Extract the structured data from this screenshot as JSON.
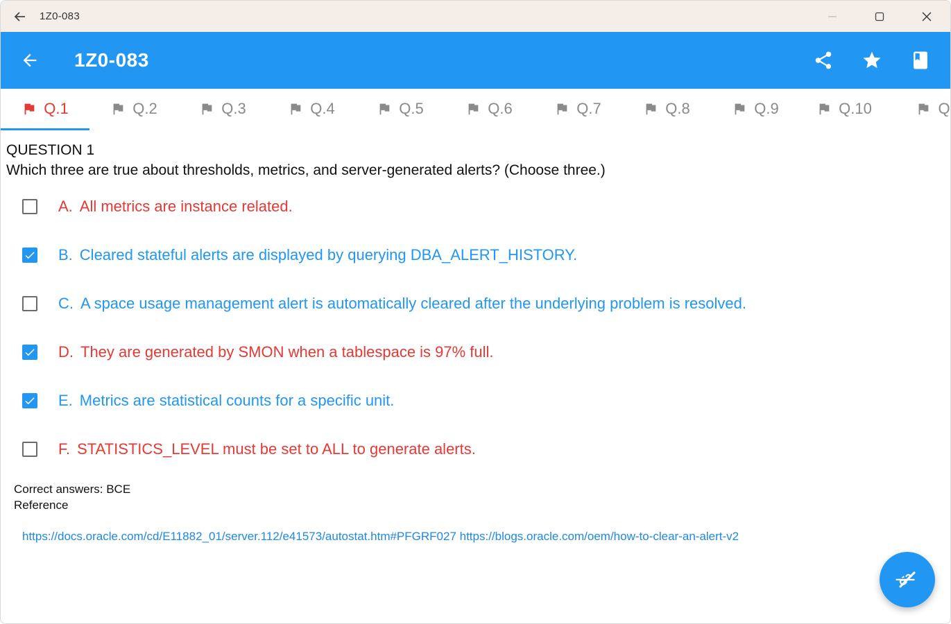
{
  "window": {
    "title": "1Z0-083"
  },
  "appbar": {
    "title": "1Z0-083",
    "accent_color": "#2196f3"
  },
  "tabs": [
    {
      "label": "Q.1",
      "active": true
    },
    {
      "label": "Q.2"
    },
    {
      "label": "Q.3"
    },
    {
      "label": "Q.4"
    },
    {
      "label": "Q.5"
    },
    {
      "label": "Q.6"
    },
    {
      "label": "Q.7"
    },
    {
      "label": "Q.8"
    },
    {
      "label": "Q.9"
    },
    {
      "label": "Q.10"
    },
    {
      "label": "Q"
    }
  ],
  "question": {
    "header": "QUESTION 1",
    "text": "Which three are true about thresholds, metrics, and server-generated alerts? (Choose three.)",
    "options": [
      {
        "letter": "A.",
        "text": "All metrics are instance related.",
        "checked": false,
        "color": "red"
      },
      {
        "letter": "B.",
        "text": "Cleared stateful alerts are displayed by querying DBA_ALERT_HISTORY.",
        "checked": true,
        "color": "blue"
      },
      {
        "letter": "C.",
        "text": "A space usage management alert is automatically cleared after the underlying problem is resolved.",
        "checked": false,
        "color": "blue"
      },
      {
        "letter": "D.",
        "text": "They are generated by SMON when a tablespace is 97% full.",
        "checked": true,
        "color": "red"
      },
      {
        "letter": "E.",
        "text": "Metrics are statistical counts for a specific unit.",
        "checked": true,
        "color": "blue"
      },
      {
        "letter": "F.",
        "text": "STATISTICS_LEVEL must be set to ALL to generate alerts.",
        "checked": false,
        "color": "red"
      }
    ],
    "correct_answers": "Correct answers: BCE",
    "reference_label": "Reference",
    "reference_link": "https://docs.oracle.com/cd/E11882_01/server.112/e41573/autostat.htm#PFGRF027 https://blogs.oracle.com/oem/how-to-clear-an-alert-v2"
  },
  "colors": {
    "correct": "#2196f3",
    "incorrect": "#e53935"
  }
}
